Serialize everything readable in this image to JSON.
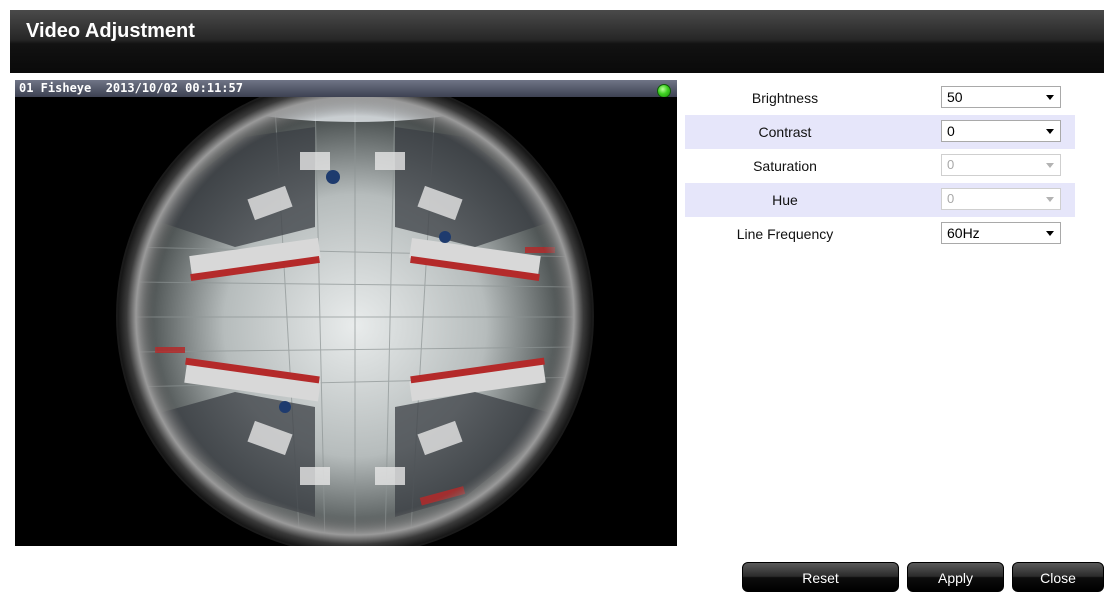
{
  "dialog": {
    "title": "Video Adjustment"
  },
  "video": {
    "camera_label": "01 Fisheye",
    "timestamp": "2013/10/02 00:11:57",
    "status": "online"
  },
  "settings": [
    {
      "label": "Brightness",
      "value": "50",
      "enabled": true
    },
    {
      "label": "Contrast",
      "value": "0",
      "enabled": true
    },
    {
      "label": "Saturation",
      "value": "0",
      "enabled": false
    },
    {
      "label": "Hue",
      "value": "0",
      "enabled": false
    },
    {
      "label": "Line Frequency",
      "value": "60Hz",
      "enabled": true
    }
  ],
  "buttons": {
    "reset": "Reset",
    "apply": "Apply",
    "close": "Close"
  },
  "colors": {
    "row_highlight": "#e6e6fa",
    "titlebar": "#1a1a1a",
    "status_led": "#3ed021"
  }
}
